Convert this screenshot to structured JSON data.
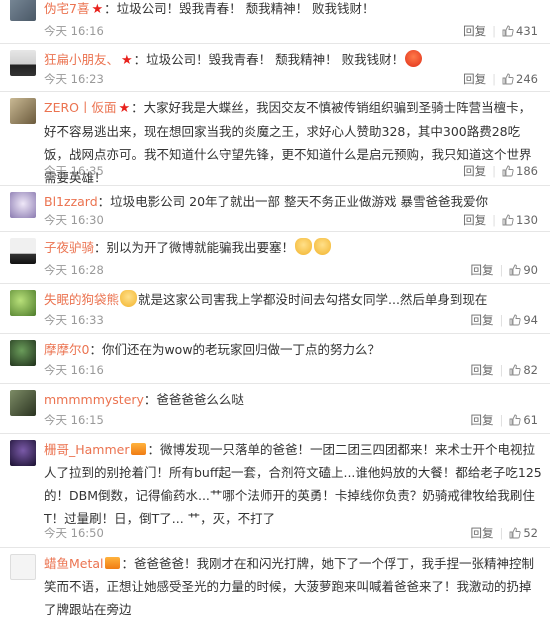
{
  "feed": {
    "reply_label": "回复",
    "comments": [
      {
        "user": "伪宅7喜",
        "badge": "★",
        "text": "：垃圾公司！毁我青春！ 颓我精神！ 败我钱财！",
        "time": "今天 16:16",
        "likes": "431",
        "avatar_colors": [
          "#7a8a99",
          "#4a5866"
        ],
        "icon": "star-badge-icon"
      },
      {
        "user": "狂扁小朋友、",
        "badge": "★",
        "text": "：垃圾公司！毁我青春！ 颓我精神！ 败我钱财！",
        "time": "今天 16:23",
        "likes": "246",
        "avatar_colors": [
          "#d8d8d8",
          "#222222"
        ],
        "icon": "angry-face-emoji-icon"
      },
      {
        "user": "ZERO丨仮面",
        "badge": "★",
        "text": "：大家好我是大蝶丝，我因交友不慎被传销组织骗到圣骑士阵营当檀卡，好不容易逃出来，现在想回家当我的炎魔之王，求好心人赞助328，其中300路费28吃饭，战网点亦可。我不知道什么守望先锋，更不知道什么是启元预购，我只知道这个世界需要英雄！",
        "time": "今天 16:35",
        "likes": "186",
        "avatar_colors": [
          "#b9a98a",
          "#6b5a3c"
        ]
      },
      {
        "user": "Bl1zzard",
        "badge": "",
        "text": "：垃圾电影公司  20年了就出一部  整天不务正业做游戏  暴雪爸爸我爱你",
        "time": "今天 16:30",
        "likes": "130",
        "avatar_colors": [
          "#dcd0ee",
          "#8a7ab0"
        ]
      },
      {
        "user": "子夜驴骑",
        "badge": "",
        "text": "：别以为开了微博就能骗我出要塞！",
        "time": "今天 16:28",
        "likes": "90",
        "avatar_colors": [
          "#e8e8e8",
          "#333333"
        ],
        "icon": "cat-face-emoji-icon"
      },
      {
        "user": "失眠的狗袋熊",
        "badge": "",
        "text": "就是这家公司害我上学都没时间去勾搭女同学...然后单身到现在",
        "time": "今天 16:33",
        "likes": "94",
        "avatar_colors": [
          "#8fc04f",
          "#4c7a2a"
        ],
        "icon": "face-emoji-icon"
      },
      {
        "user": "摩摩尔0",
        "badge": "",
        "text": "：你们还在为wow的老玩家回归做一丁点的努力么？",
        "time": "今天 16:16",
        "likes": "82",
        "avatar_colors": [
          "#3e6b3a",
          "#1e2e1a"
        ]
      },
      {
        "user": "mmmmmystery",
        "badge": "",
        "text": "：爸爸爸爸么么哒",
        "time": "今天 16:15",
        "likes": "61",
        "avatar_colors": [
          "#5a6a4a",
          "#2a3320"
        ]
      },
      {
        "user": "栅哥_Hammer",
        "badge": "",
        "text": "：微博发现一只落单的爸爸！一团二团三四团都来！来术士开个电视拉人了拉到的别抢着门！所有buff起一套，合剂符文磕上...谁他妈放的大餐！都给老子吃125的！DBM倒数，记得偷药水...艹哪个法师开的英勇！卡掉线你负责？奶骑戒律牧给我刷住T！过量刷！日，倒T了... 艹，灭，不打了",
        "time": "今天 16:50",
        "likes": "52",
        "avatar_colors": [
          "#4a3a6a",
          "#1a1030"
        ],
        "icon": "vip-badge-icon"
      },
      {
        "user": "蜡鱼Metal",
        "badge": "",
        "text": "：爸爸爸爸！我刚才在和闪光打牌，她下了一个俘丁，我手捏一张精神控制笑而不语，正想让她感受圣光的力量的时候，大菠萝跑来叫喊着爸爸来了！我激动的扔掉了牌跟站在旁边",
        "time": "",
        "likes": "",
        "avatar_colors": [
          "#f2f2f2",
          "#555555"
        ],
        "icon": "vip-badge-icon"
      }
    ]
  }
}
